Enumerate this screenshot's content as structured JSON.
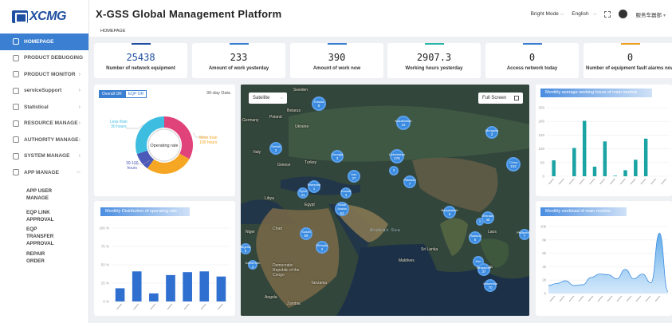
{
  "brand": {
    "logo_text": "XCMG"
  },
  "header": {
    "title": "X-GSS Global Management Platform",
    "mode": "Bright Mode",
    "language": "English",
    "user": "服务车器部"
  },
  "breadcrumb": "HOMEPAGE",
  "sidebar": {
    "items": [
      {
        "label": "HOMEPAGE",
        "icon": "home-icon",
        "active": true
      },
      {
        "label": "PRODUCT DEBUGGING",
        "icon": "calendar-icon"
      },
      {
        "label": "PRODUCT MONITOR",
        "icon": "monitor-icon"
      },
      {
        "label": "serviceSupport",
        "icon": "grid-icon"
      },
      {
        "label": "Statistical",
        "icon": "clock-icon"
      },
      {
        "label": "RESOURCE MANAGE",
        "icon": "database-icon"
      },
      {
        "label": "AUTHORITY MANAGE",
        "icon": "lock-icon"
      },
      {
        "label": "SYSTEM MANAGE",
        "icon": "gear-icon"
      },
      {
        "label": "APP MANAGE",
        "icon": "shield-icon",
        "expanded": true
      }
    ],
    "subitems": [
      "APP USER MANAGE",
      "EQP LINK APPROVAL",
      "EQP TRANSFER APPROVAL",
      "REPAIR ORDER"
    ]
  },
  "stats": [
    {
      "value": "25438",
      "label": "Number of network equipment",
      "color": "#1f4fa0"
    },
    {
      "value": "233",
      "label": "Amount of work yesterday",
      "color": "#3a7fd1"
    },
    {
      "value": "390",
      "label": "Amount of work now",
      "color": "#3a7fd1"
    },
    {
      "value": "2907.3",
      "label": "Working hours yesterday",
      "color": "#2bb5a8"
    },
    {
      "value": "0",
      "label": "Access network today",
      "color": "#3a7fd1"
    },
    {
      "value": "0",
      "label": "Number of equipment fault alarms now",
      "color": "#f0a020"
    }
  ],
  "donut": {
    "tabs": [
      "Overall OR",
      "EQP OR"
    ],
    "period": "30-day Data",
    "center": "Operating rate",
    "segments": [
      {
        "label": "More than 100 hours",
        "value": 33,
        "color": "#e0427a"
      },
      {
        "label": "Orange",
        "value": 27,
        "color": "#f5a623"
      },
      {
        "label": "30-100 hours",
        "value": 10,
        "color": "#4b59b8"
      },
      {
        "label": "Less than 30 hours",
        "value": 30,
        "color": "#3dbde0"
      }
    ],
    "labels": {
      "more": "More than\n100 hours",
      "mid": "30-100\nhours",
      "less": "Less than\n30 hours"
    }
  },
  "map": {
    "layer": "Satellite",
    "fullscreen": "Full Screen",
    "clusters": [
      {
        "name": "Russia",
        "count": "9"
      },
      {
        "name": "Kazakhstan",
        "count": "12"
      },
      {
        "name": "Mongolia",
        "count": "2"
      },
      {
        "name": "Serbia",
        "count": "2"
      },
      {
        "name": "Georgia",
        "count": "3"
      },
      {
        "name": "Uzbekistan",
        "count": "276"
      },
      {
        "name": "",
        "count": "3"
      },
      {
        "name": "China",
        "count": "152"
      },
      {
        "name": "Palestine",
        "count": "1"
      },
      {
        "name": "Syria",
        "count": "41"
      },
      {
        "name": "Iran",
        "count": "27"
      },
      {
        "name": "Pakistan",
        "count": "7"
      },
      {
        "name": "Kuwait",
        "count": "3"
      },
      {
        "name": "Saudi Arabia",
        "count": "52"
      },
      {
        "name": "Bangladesh",
        "count": "5"
      },
      {
        "name": "Vietnam",
        "count": "45"
      },
      {
        "name": "Sudan",
        "count": "59"
      },
      {
        "name": "Thailand",
        "count": "5"
      },
      {
        "name": "Ethiopia",
        "count": "2"
      },
      {
        "name": "Nigeria",
        "count": "6"
      },
      {
        "name": "Cameroon",
        "count": "1"
      },
      {
        "name": "Mor",
        "count": ""
      },
      {
        "name": "Singapore",
        "count": "37"
      },
      {
        "name": "Indonesia",
        "count": "70"
      },
      {
        "name": "Philippines",
        "count": "7"
      },
      {
        "name": "",
        "count": "1"
      }
    ],
    "places": [
      "Sweden",
      "Belarus",
      "Germany",
      "Poland",
      "Ukraine",
      "Italy",
      "Greece",
      "Turkey",
      "Libya",
      "Egypt",
      "Chad",
      "Niger",
      "Arabian Sea",
      "Maldives",
      "Sri Lanka",
      "Democratic Republic of the Congo",
      "Tanzania",
      "Angola",
      "Zambia",
      "Laos",
      "Malaysia",
      "Kyrgyzstan",
      "Tajikistan",
      "Oman",
      "Yemen"
    ]
  },
  "bar_operating": {
    "title": "Monthly Distribution of operating rate",
    "chart_data": {
      "type": "bar",
      "categories": [
        "",
        "",
        "",
        "",
        "",
        "",
        ""
      ],
      "values": [
        18,
        41,
        11,
        36,
        40,
        41,
        34
      ],
      "ylim": [
        0,
        100
      ],
      "yticks": [
        "0 %",
        "25 %",
        "50 %",
        "75 %",
        "100 %"
      ],
      "color": "#2f6fcf"
    }
  },
  "bar_hours": {
    "title": "Monthly average working hours of main models",
    "chart_data": {
      "type": "bar",
      "categories": [
        "",
        "",
        "",
        "",
        "",
        "",
        "",
        "",
        "",
        "",
        "",
        ""
      ],
      "series": [
        {
          "values": [
            0,
            0,
            0,
            0,
            0,
            0,
            0,
            0,
            0,
            0,
            0,
            0
          ],
          "color": "#2f6fcf"
        },
        {
          "values": [
            58,
            0,
            103,
            202,
            35,
            127,
            2,
            22,
            60,
            137,
            0,
            0
          ],
          "color": "#1aa3a3"
        }
      ],
      "ylim": [
        0,
        250
      ],
      "yticks": [
        "0",
        "50",
        "100",
        "150",
        "200",
        "250"
      ]
    }
  },
  "area_workload": {
    "title": "Monthly workload of main models",
    "chart_data": {
      "type": "area",
      "x": [
        1,
        2,
        3,
        4,
        5,
        6,
        7,
        8,
        9,
        10,
        11,
        12,
        13,
        14,
        15
      ],
      "values": [
        1.2,
        1.5,
        1.9,
        1.2,
        1.3,
        2.4,
        2.9,
        2.8,
        2.2,
        3.6,
        2.2,
        2.9,
        1.6,
        9.0,
        0.3
      ],
      "ylim": [
        0,
        10
      ],
      "yticks": [
        "0",
        "2k",
        "4k",
        "6k",
        "8k",
        "10k"
      ],
      "color": "#5aa8e8"
    }
  }
}
